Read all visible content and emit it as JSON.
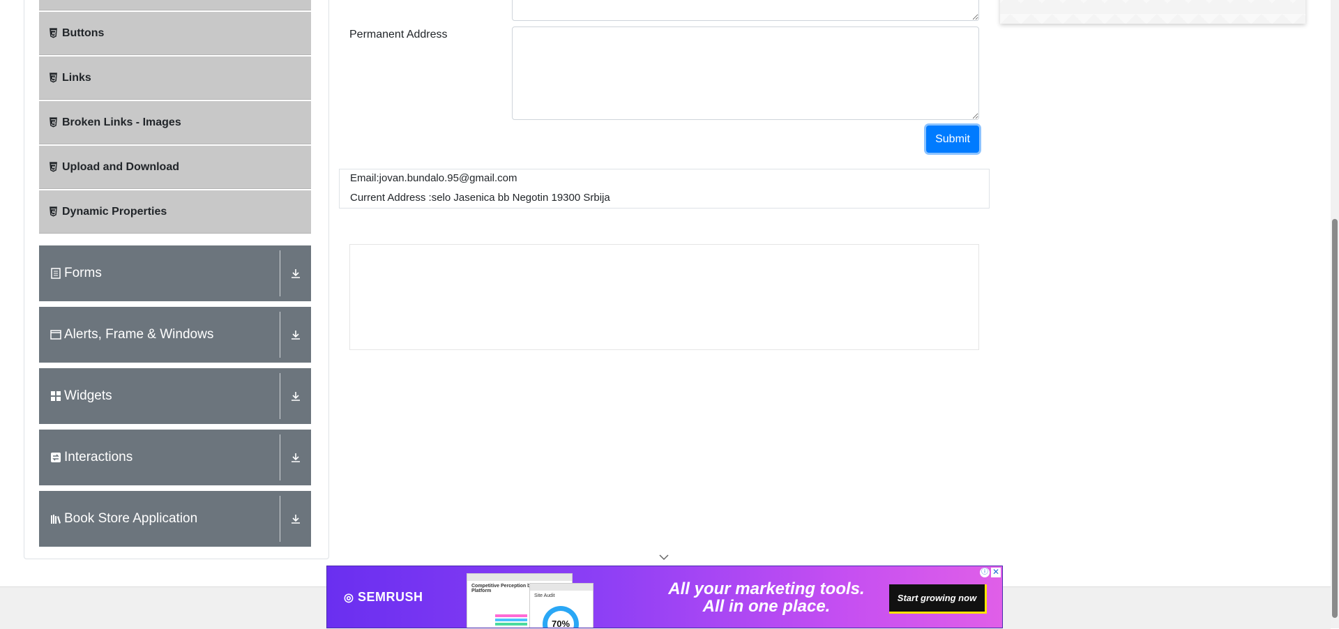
{
  "sidebar": {
    "sub_items": [
      {
        "label": "Buttons"
      },
      {
        "label": "Links"
      },
      {
        "label": "Broken Links - Images"
      },
      {
        "label": "Upload and Download"
      },
      {
        "label": "Dynamic Properties"
      }
    ],
    "groups": [
      {
        "label": "Forms",
        "icon": "form-icon"
      },
      {
        "label": "Alerts, Frame & Windows",
        "icon": "window-icon"
      },
      {
        "label": "Widgets",
        "icon": "widgets-icon"
      },
      {
        "label": "Interactions",
        "icon": "interactions-icon"
      },
      {
        "label": "Book Store Application",
        "icon": "books-icon"
      }
    ]
  },
  "form": {
    "permanent_address_label": "Permanent Address",
    "permanent_address_value": "",
    "submit_label": "Submit"
  },
  "output": {
    "email_line": "Email:jovan.bundalo.95@gmail.com",
    "current_address_line": "Current Address :selo Jasenica bb Negotin 19300 Srbija"
  },
  "ad": {
    "brand": "SEMRUSH",
    "headline_line1": "All your marketing tools.",
    "headline_line2": "All in one place.",
    "cta": "Start growing now",
    "shot_title": "Competitive Perception by Platform",
    "shot2_title": "Site Audit",
    "shot2_value": "70%"
  },
  "colors": {
    "accent": "#007bff",
    "group_bg": "#6c757d",
    "subitem_bg": "#c8c8c8"
  }
}
